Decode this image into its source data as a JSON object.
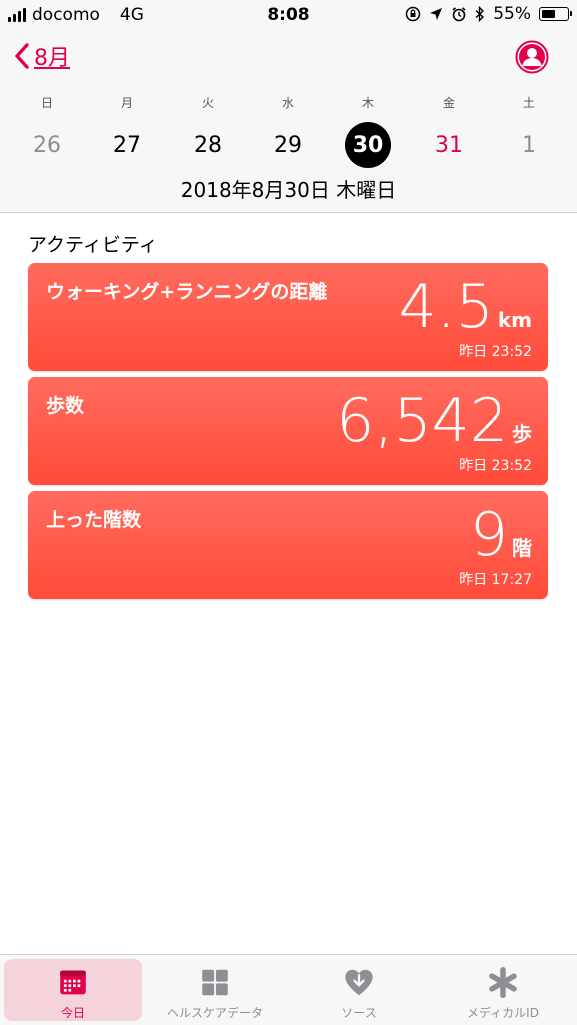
{
  "status_bar": {
    "carrier": "docomo",
    "network": "4G",
    "time": "8:08",
    "battery": "55%",
    "battery_level": 0.55
  },
  "header": {
    "back_label": "8月",
    "weekdays": [
      "日",
      "月",
      "火",
      "水",
      "木",
      "金",
      "土"
    ],
    "dates": [
      "26",
      "27",
      "28",
      "29",
      "30",
      "31",
      "1"
    ],
    "selected_index": 4,
    "full_date": "2018年8月30日 木曜日"
  },
  "section": {
    "title": "アクティビティ"
  },
  "cards": [
    {
      "title": "ウォーキング+ランニングの距離",
      "value": "4.5",
      "unit": "km",
      "time": "昨日 23:52"
    },
    {
      "title": "歩数",
      "value": "6,542",
      "unit": "歩",
      "time": "昨日 23:52"
    },
    {
      "title": "上った階数",
      "value": "9",
      "unit": "階",
      "time": "昨日 17:27"
    }
  ],
  "tabs": [
    {
      "label": "今日",
      "icon": "calendar-icon",
      "active": true
    },
    {
      "label": "ヘルスケアデータ",
      "icon": "grid-icon",
      "active": false
    },
    {
      "label": "ソース",
      "icon": "heart-download-icon",
      "active": false
    },
    {
      "label": "メディカルID",
      "icon": "asterisk-icon",
      "active": false
    }
  ],
  "colors": {
    "accent": "#e0004d",
    "card": "#ff5a4a",
    "sunday": "#8e8e93",
    "friday": "#e0004d"
  }
}
